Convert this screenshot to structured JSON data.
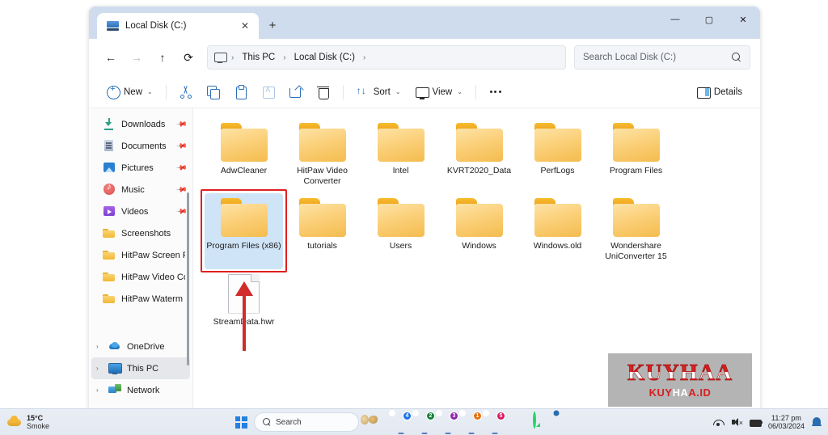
{
  "window": {
    "tab": {
      "title": "Local Disk (C:)",
      "icon": "local-disk-icon",
      "close_label": "✕"
    },
    "new_tab_label": "+",
    "controls": {
      "minimize": "—",
      "maximize": "▢",
      "close": "✕"
    }
  },
  "navigation": {
    "back": "←",
    "forward": "→",
    "up": "↑",
    "refresh": "⟳",
    "breadcrumb": [
      "This PC",
      "Local Disk (C:)"
    ],
    "separator": "›"
  },
  "search": {
    "placeholder": "Search Local Disk (C:)",
    "icon": "search-icon"
  },
  "toolbar": {
    "new_label": "New",
    "cut_label": "Cut",
    "copy_label": "Copy",
    "paste_label": "Paste",
    "rename_label": "Rename",
    "share_label": "Share",
    "delete_label": "Delete",
    "sort_label": "Sort",
    "view_label": "View",
    "more_label": "See more",
    "details_label": "Details",
    "chevron": "⌄"
  },
  "sidebar": {
    "items": [
      {
        "label": "Downloads",
        "icon": "download-icon",
        "pinned": true,
        "chevron": ""
      },
      {
        "label": "Documents",
        "icon": "documents-icon",
        "pinned": true,
        "chevron": ""
      },
      {
        "label": "Pictures",
        "icon": "pictures-icon",
        "pinned": true,
        "chevron": ""
      },
      {
        "label": "Music",
        "icon": "music-icon",
        "pinned": true,
        "chevron": ""
      },
      {
        "label": "Videos",
        "icon": "videos-icon",
        "pinned": true,
        "chevron": ""
      },
      {
        "label": "Screenshots",
        "icon": "folder-icon",
        "pinned": false,
        "chevron": ""
      },
      {
        "label": "HitPaw Screen R",
        "icon": "folder-icon",
        "pinned": false,
        "chevron": ""
      },
      {
        "label": "HitPaw Video Co",
        "icon": "folder-icon",
        "pinned": false,
        "chevron": ""
      },
      {
        "label": "HitPaw Waterm",
        "icon": "folder-icon",
        "pinned": false,
        "chevron": ""
      }
    ],
    "roots": [
      {
        "label": "OneDrive",
        "icon": "onedrive-icon",
        "chevron": "›",
        "selected": false
      },
      {
        "label": "This PC",
        "icon": "this-pc-icon",
        "chevron": "›",
        "selected": true
      },
      {
        "label": "Network",
        "icon": "network-icon",
        "chevron": "›",
        "selected": false
      }
    ]
  },
  "files": [
    {
      "name": "AdwCleaner",
      "type": "folder",
      "selected": false
    },
    {
      "name": "HitPaw Video Converter",
      "type": "folder",
      "selected": false
    },
    {
      "name": "Intel",
      "type": "folder",
      "selected": false
    },
    {
      "name": "KVRT2020_Data",
      "type": "folder",
      "selected": false
    },
    {
      "name": "PerfLogs",
      "type": "folder",
      "selected": false
    },
    {
      "name": "Program Files",
      "type": "folder",
      "selected": false
    },
    {
      "name": "Program Files (x86)",
      "type": "folder",
      "selected": true
    },
    {
      "name": "tutorials",
      "type": "folder",
      "selected": false
    },
    {
      "name": "Users",
      "type": "folder",
      "selected": false
    },
    {
      "name": "Windows",
      "type": "folder",
      "selected": false
    },
    {
      "name": "Windows.old",
      "type": "folder",
      "selected": false
    },
    {
      "name": "Wondershare UniConverter 15",
      "type": "folder",
      "selected": false
    },
    {
      "name": "StreamData.hwr",
      "type": "file",
      "selected": false
    }
  ],
  "annotations": {
    "highlight_color": "#e02020",
    "highlight_target": "Program Files (x86)",
    "arrow_direction": "up"
  },
  "watermark": {
    "title": "KUYHAA",
    "subtitle_red1": "KUY",
    "subtitle_white": "HA",
    "subtitle_red2": "A.ID"
  },
  "taskbar": {
    "weather": {
      "temperature": "15°C",
      "condition": "Smoke"
    },
    "start_label": "Start",
    "search_placeholder": "Search",
    "apps": [
      {
        "name": "paint-app-icon",
        "badge": ""
      },
      {
        "name": "chrome-icon",
        "badge": "4",
        "badge_color": "#1a73e8"
      },
      {
        "name": "chrome-icon",
        "badge": "2",
        "badge_color": "#188038"
      },
      {
        "name": "chrome-icon",
        "badge": "3",
        "badge_color": "#8e24aa"
      },
      {
        "name": "chrome-icon",
        "badge": "1",
        "badge_color": "#e8710a"
      },
      {
        "name": "chrome-icon",
        "badge": "5",
        "badge_color": "#d81b60"
      },
      {
        "name": "file-explorer-icon",
        "badge": ""
      },
      {
        "name": "whatsapp-icon",
        "badge": ""
      },
      {
        "name": "settings-icon",
        "badge": ""
      }
    ],
    "tray": {
      "wifi": "wifi-icon",
      "volume": "volume-muted-icon",
      "battery": "battery-icon",
      "time": "11:27 pm",
      "date": "06/03/2024",
      "notifications": "bell-icon"
    }
  }
}
